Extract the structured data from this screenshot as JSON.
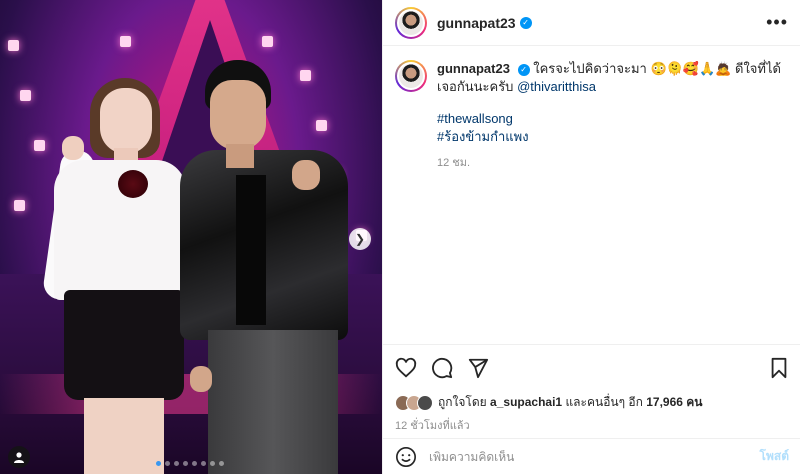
{
  "post": {
    "username": "gunnapat23",
    "more_icon": "more-horizontal-icon",
    "caption": {
      "text": "ใครจะไปคิดว่าจะมา 😳🫠🥰🙏🙇 ดีใจที่ได้เจอกันนะครับ",
      "mention": "@thivaritthisa",
      "hashtags": [
        "#thewallsong",
        "#ร้องข้ามกำแพง"
      ],
      "time": "12 ชม."
    },
    "likes": {
      "prefix": "ถูกใจโดย",
      "first_user": "a_supachai1",
      "connector": "และคนอื่นๆ อีก",
      "count": "17,966",
      "suffix": "คน"
    },
    "posted_ago": "12 ชั่วโมงที่แล้ว",
    "comment": {
      "placeholder": "เพิ่มความคิดเห็น",
      "post_label": "โพสต์"
    },
    "carousel": {
      "slides": 8,
      "active_index": 0
    },
    "colors": {
      "verified": "#0095f6",
      "link": "#00376b",
      "post_button_disabled": "#b2dffc",
      "active_dot": "#3897f0"
    }
  }
}
